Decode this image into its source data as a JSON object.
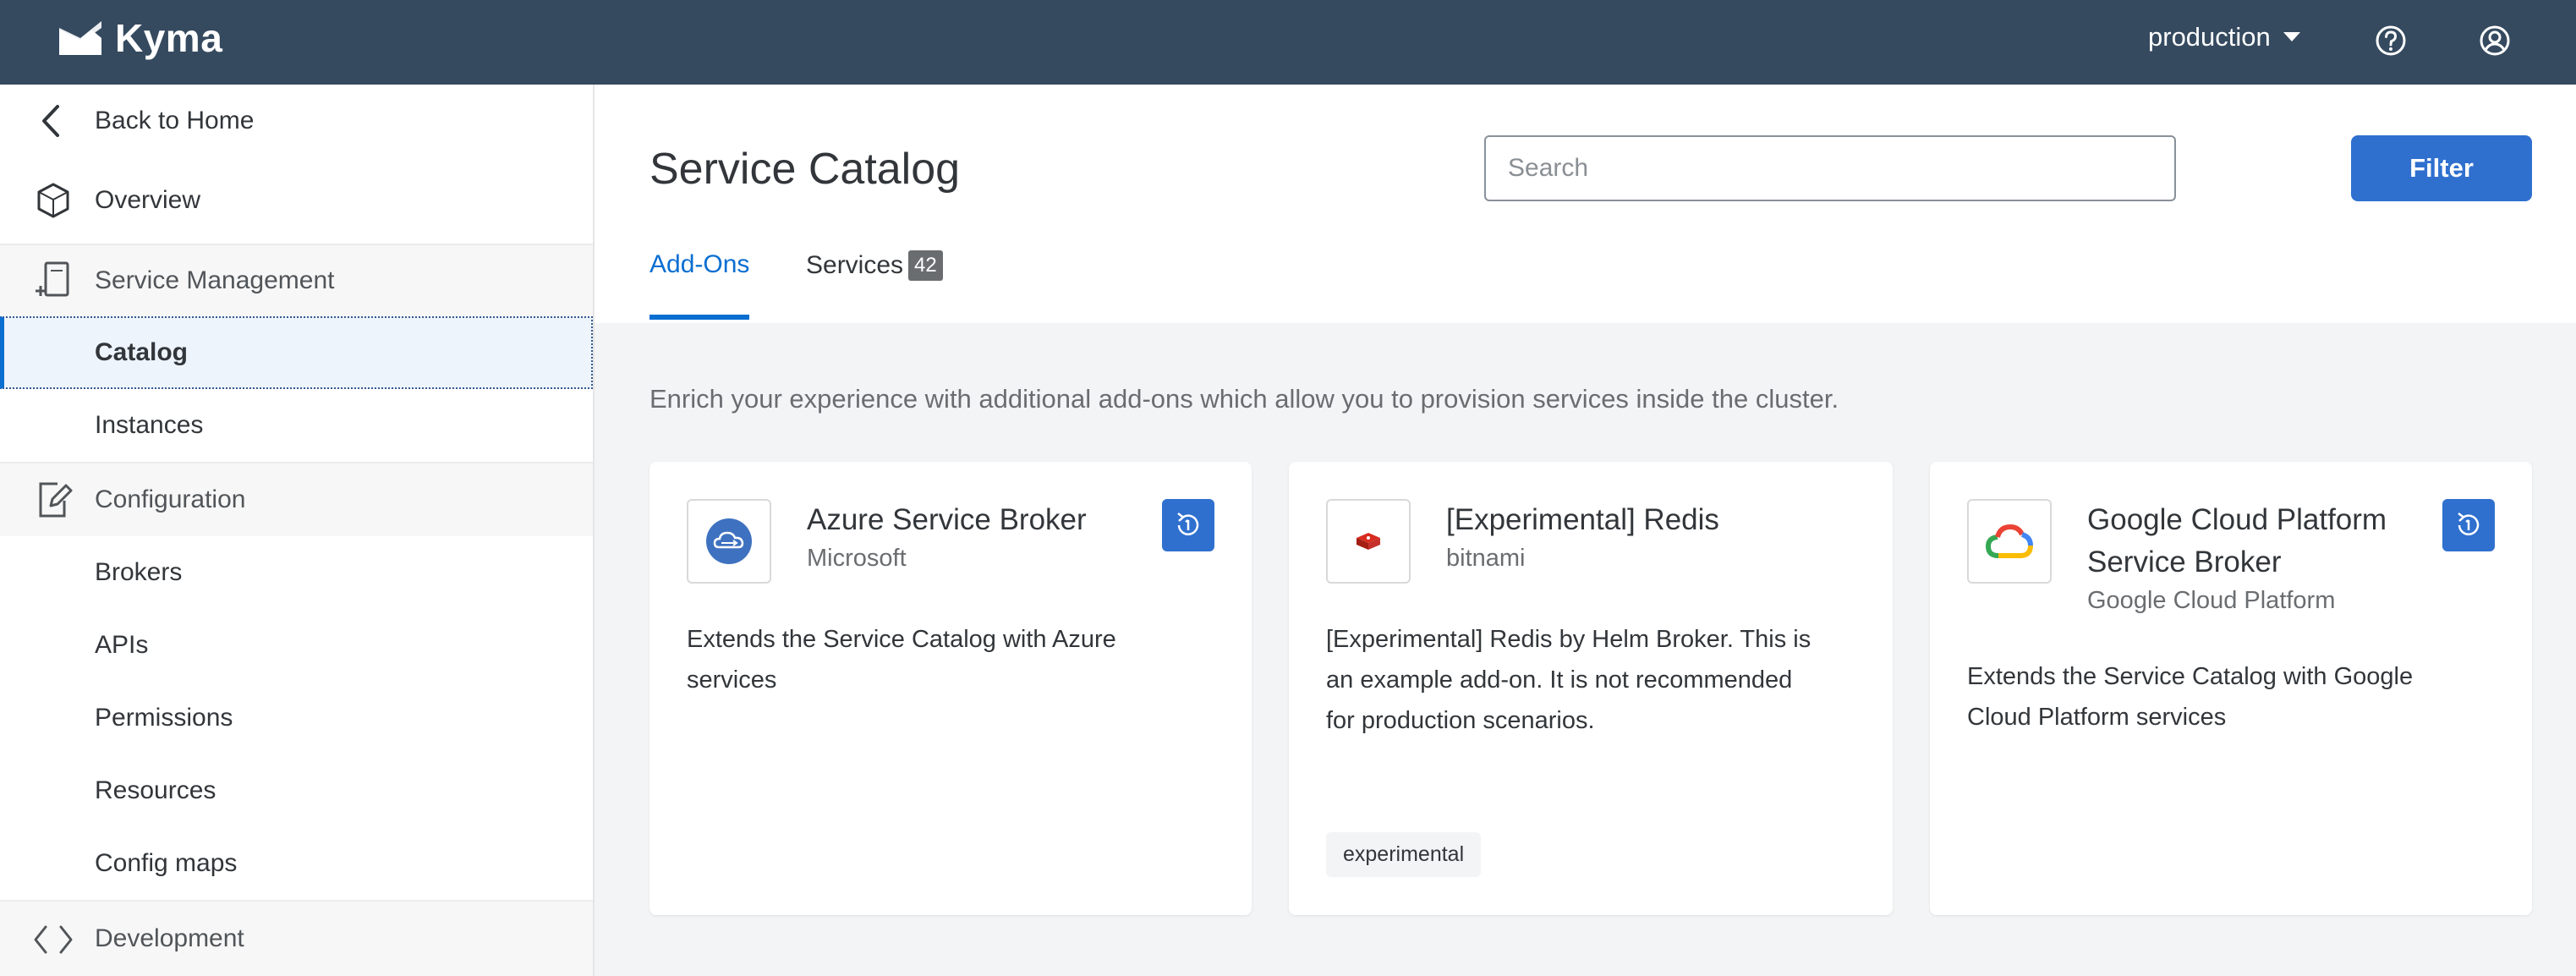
{
  "topbar": {
    "brand": "Kyma",
    "namespace": "production",
    "icons": [
      "kyma-logo-icon",
      "chevron-down-icon",
      "help-icon",
      "user-icon"
    ]
  },
  "sidebar": {
    "back": "Back to Home",
    "overview": "Overview",
    "service_management": "Service Management",
    "catalog": "Catalog",
    "instances": "Instances",
    "configuration": "Configuration",
    "brokers": "Brokers",
    "apis": "APIs",
    "permissions": "Permissions",
    "resources": "Resources",
    "config_maps": "Config maps",
    "development": "Development"
  },
  "header": {
    "title": "Service Catalog",
    "search_placeholder": "Search",
    "filter_label": "Filter",
    "tabs": [
      {
        "label": "Add-Ons",
        "active": true
      },
      {
        "label": "Services",
        "count": "42",
        "active": false
      }
    ]
  },
  "main": {
    "intro": "Enrich your experience with additional add-ons which allow you to provision services inside the cluster.",
    "cards": [
      {
        "title_lines": [
          "Azure Service Broker"
        ],
        "provider": "Microsoft",
        "desc_lines": [
          "Extends the Service Catalog with Azure",
          "services"
        ],
        "logo": "azure-cloud-icon",
        "action_icon": "instance-icon"
      },
      {
        "title_lines": [
          "[Experimental] Redis"
        ],
        "provider": "bitnami",
        "desc_lines": [
          "[Experimental] Redis by Helm Broker. This is",
          "an example add-on. It is not recommended",
          "for production scenarios."
        ],
        "tag": "experimental",
        "logo": "redis-icon"
      },
      {
        "title_lines": [
          "Google Cloud Platform",
          "Service Broker"
        ],
        "provider": "Google Cloud Platform",
        "desc_lines": [
          "Extends the Service Catalog with Google",
          "Cloud Platform services"
        ],
        "logo": "google-cloud-icon",
        "action_icon": "instance-icon"
      }
    ]
  },
  "colors": {
    "shell": "#354a5f",
    "accent": "#0a6ed1",
    "button": "#2f70cf",
    "background": "#f3f4f5"
  }
}
